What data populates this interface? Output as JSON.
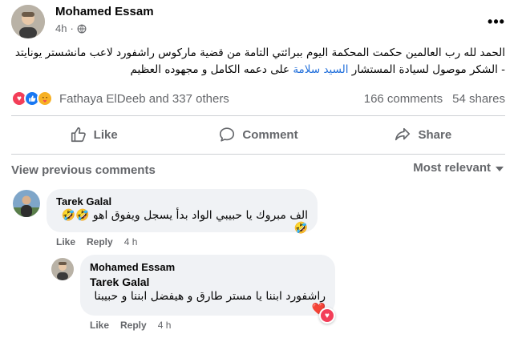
{
  "post": {
    "author": "Mohamed Essam",
    "time": "4h",
    "time_sep": "·",
    "more_label": "•••",
    "text_line1": "الحمد لله رب العالمين حكمت المحكمة اليوم ببرائتي التامة من قضية ماركوس راشفورد لاعب مانشستر يونايتد",
    "text_line2_a": "- الشكر موصول لسيادة المستشار ",
    "text_line2_link": "السيد سلامة",
    "text_line2_b": " على دعمه الكامل و مجهوده العظيم"
  },
  "reactions": {
    "icons": [
      "love-icon",
      "like-icon",
      "care-icon"
    ],
    "names": "Fathaya ElDeeb and 337 others",
    "comments_count": "166 comments",
    "shares_count": "54 shares"
  },
  "actions": {
    "like": "Like",
    "comment": "Comment",
    "share": "Share"
  },
  "comments_header": {
    "view_previous": "View previous comments",
    "sort": "Most relevant"
  },
  "comments": [
    {
      "author": "Tarek Galal",
      "text": "الف مبروك يا حبيبي الواد بدأ يسجل ويفوق اهو 🤣🤣🤣",
      "like": "Like",
      "reply": "Reply",
      "time": "4 h"
    },
    {
      "author": "Mohamed Essam",
      "mention": "Tarek Galal",
      "text": "راشفورد ابننا يا مستر طارق و هيفضل ابننا و حبيبنا❤️",
      "like": "Like",
      "reply": "Reply",
      "time": "4 h"
    }
  ],
  "colors": {
    "link_blue": "#216fdb",
    "secondary_text": "#65676b",
    "bubble_bg": "#f0f2f5",
    "love_red": "#f33e58",
    "like_blue": "#1877f2"
  }
}
